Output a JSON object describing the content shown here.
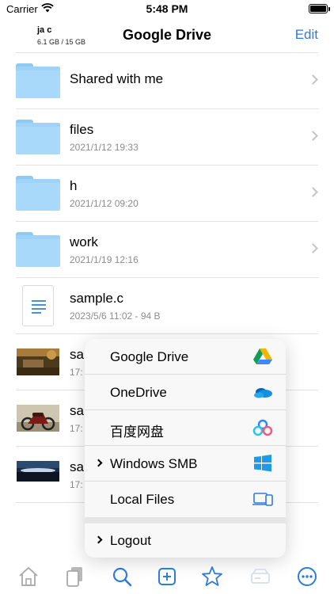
{
  "status": {
    "carrier": "Carrier",
    "time": "5:48 PM"
  },
  "nav": {
    "account_name": "ja c",
    "account_usage": "6.1 GB / 15 GB",
    "title": "Google Drive",
    "edit_label": "Edit"
  },
  "files": [
    {
      "name": "Shared with me",
      "meta": "",
      "kind": "folder"
    },
    {
      "name": "files",
      "meta": "2021/1/12 19:33",
      "kind": "folder"
    },
    {
      "name": "h",
      "meta": "2021/1/12 09:20",
      "kind": "folder"
    },
    {
      "name": "work",
      "meta": "2021/1/19 12:16",
      "kind": "folder"
    },
    {
      "name": "sample.c",
      "meta": "2023/5/6 11:02 - 94 B",
      "kind": "document"
    },
    {
      "name": "sa",
      "meta": "17:",
      "kind": "photo-landscape"
    },
    {
      "name": "sa",
      "meta": "17:",
      "kind": "photo-motorcycle"
    },
    {
      "name": "sa",
      "meta": "17:",
      "kind": "photo-horizon"
    }
  ],
  "menu": {
    "items": [
      {
        "label": "Google Drive",
        "icon": "google-drive-icon",
        "chevron": false
      },
      {
        "label": "OneDrive",
        "icon": "onedrive-icon",
        "chevron": false
      },
      {
        "label": "百度网盘",
        "icon": "baidu-netdisk-icon",
        "chevron": false
      },
      {
        "label": "Windows SMB",
        "icon": "windows-icon",
        "chevron": true
      },
      {
        "label": "Local Files",
        "icon": "devices-icon",
        "chevron": false
      }
    ],
    "logout_label": "Logout"
  },
  "tabbar": {
    "items": [
      "home-icon",
      "copy-icon",
      "search-icon",
      "add-icon",
      "star-icon",
      "drive-icon",
      "more-icon"
    ]
  },
  "colors": {
    "accent": "#2f7bd8",
    "folder": "#a9d9fa",
    "chevron": "#c3c3c8"
  }
}
